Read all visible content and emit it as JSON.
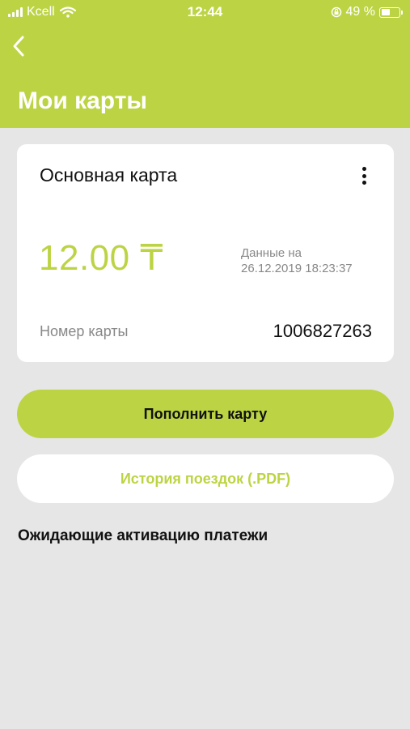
{
  "colors": {
    "accent": "#bcd444",
    "background": "#e6e6e6",
    "card": "#ffffff",
    "muted": "#888888"
  },
  "status_bar": {
    "carrier": "Kcell",
    "time": "12:44",
    "battery_percent": "49 %",
    "battery_level": 0.49,
    "icons": [
      "signal-icon",
      "wifi-icon",
      "rotation-lock-icon",
      "battery-icon"
    ]
  },
  "nav": {
    "back_icon": "chevron-left-icon"
  },
  "header": {
    "title": "Мои карты"
  },
  "card": {
    "title": "Основная карта",
    "menu_icon": "more-vertical-icon",
    "balance": "12.00 ₸",
    "updated_label": "Данные на",
    "updated_at": "26.12.2019 18:23:37",
    "number_label": "Номер карты",
    "number": "1006827263"
  },
  "actions": {
    "topup_label": "Пополнить карту",
    "history_label": "История поездок (.PDF)"
  },
  "pending": {
    "heading": "Ожидающие активацию платежи"
  }
}
